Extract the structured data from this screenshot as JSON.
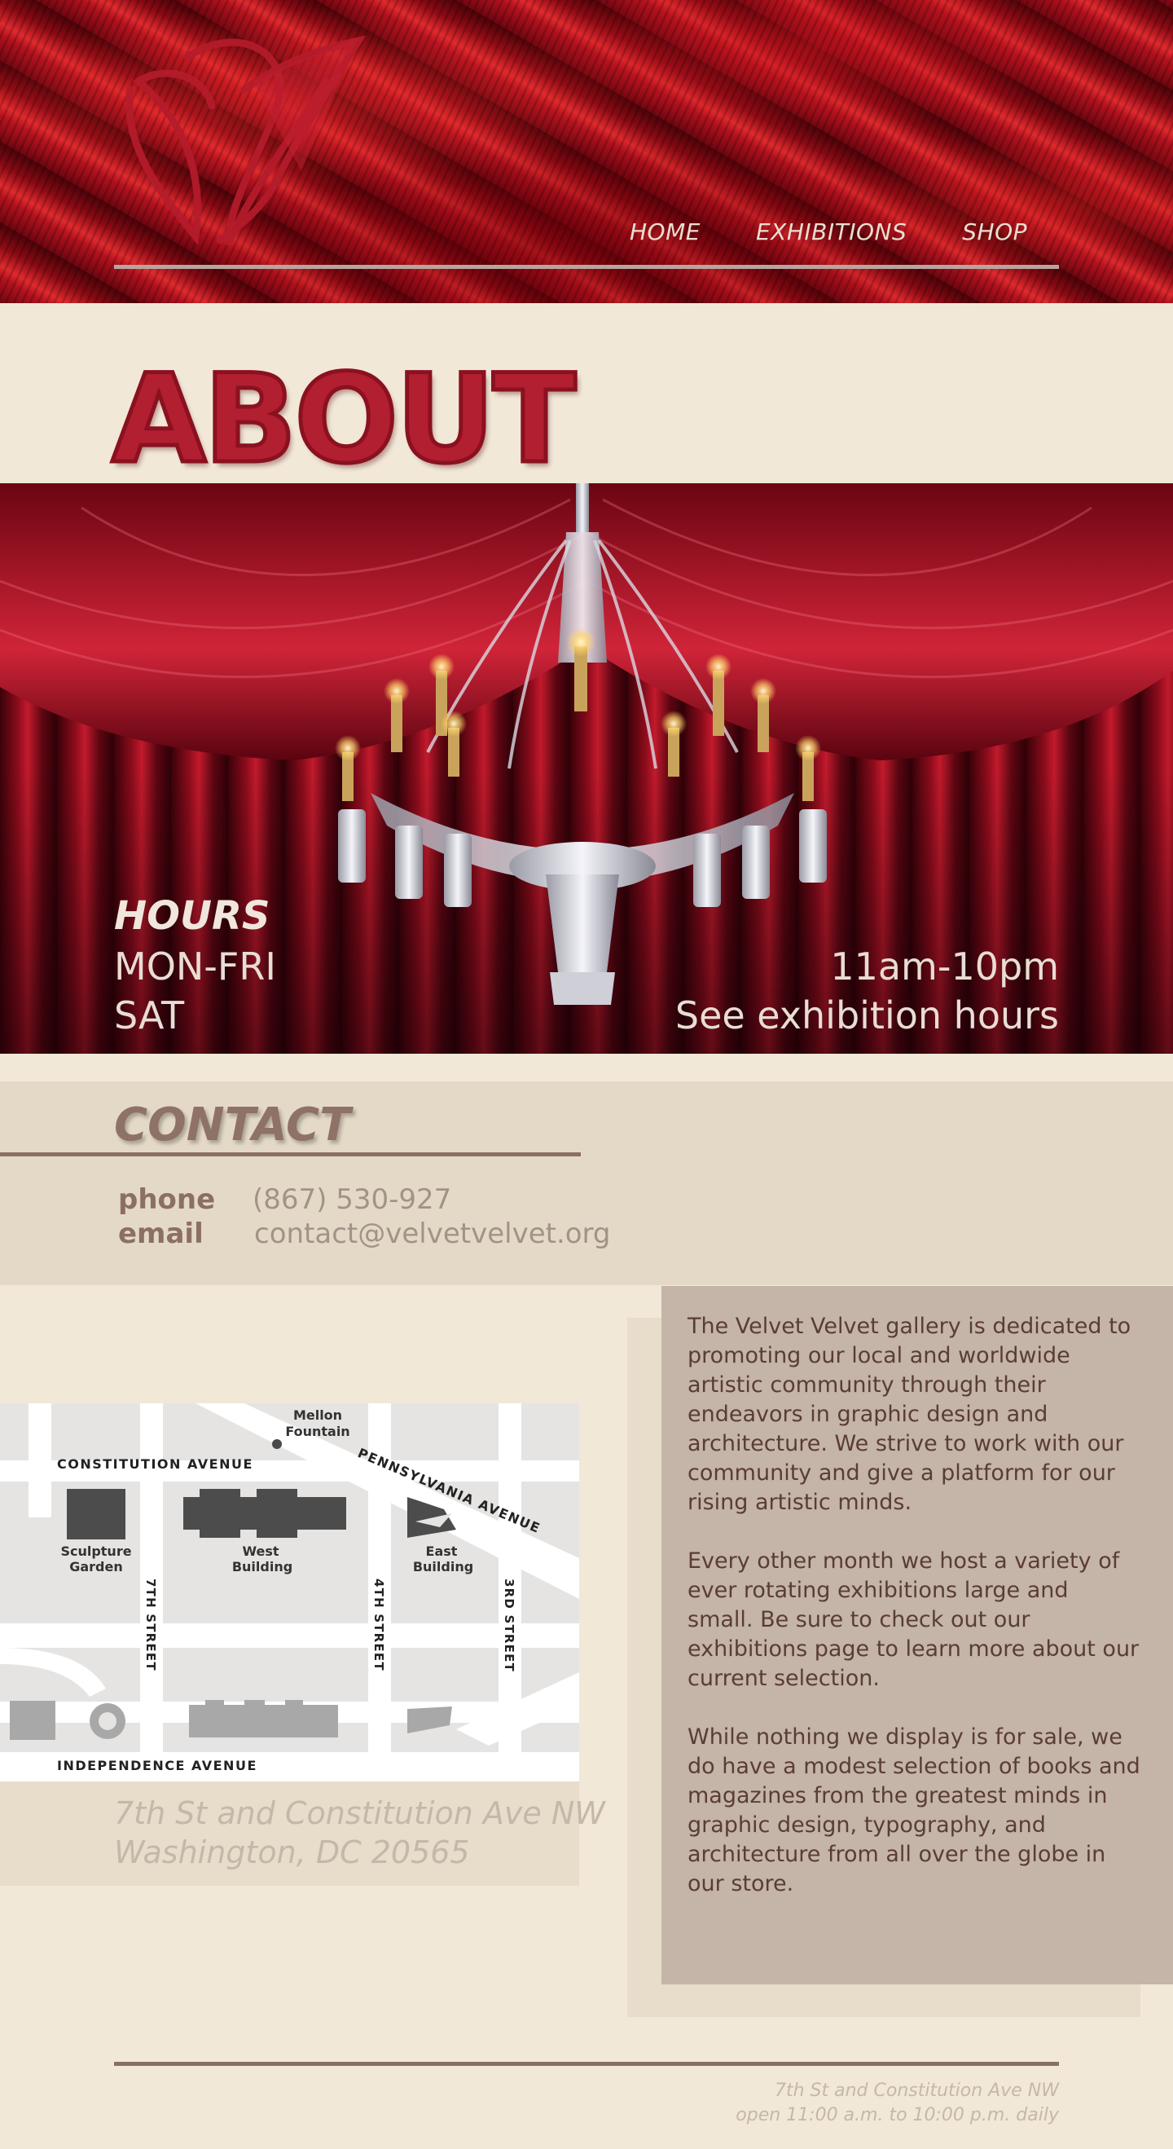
{
  "header": {
    "logo_icon": "velvet-v-monogram-logo",
    "nav": [
      {
        "label": "HOME"
      },
      {
        "label": "EXHIBITIONS"
      },
      {
        "label": "SHOP"
      }
    ]
  },
  "about": {
    "title": "ABOUT"
  },
  "hero": {
    "image": "chandelier-red-velvet-drapes",
    "hours_label": "HOURS",
    "days": [
      "MON-FRI",
      "SAT"
    ],
    "times": [
      "11am-10pm",
      "See exhibition hours"
    ]
  },
  "contact": {
    "title": "CONTACT",
    "phone_label": "phone",
    "phone_value": "(867) 530-927",
    "email_label": "email",
    "email_value": "contact@velvetvelvet.org"
  },
  "map": {
    "labels": {
      "mellon": "Mellon",
      "fountain": "Fountain",
      "constitution": "CONSTITUTION AVENUE",
      "pennsylvania": "PENNSYLVANIA AVENUE",
      "sculpture_1": "Sculpture",
      "sculpture_2": "Garden",
      "west_1": "West",
      "west_2": "Building",
      "east_1": "East",
      "east_2": "Building",
      "seventh": "7TH STREET",
      "fourth": "4TH STREET",
      "third": "3RD STREET",
      "independence": "INDEPENDENCE AVENUE"
    },
    "address_line_1": "7th St and Constitution Ave NW",
    "address_line_2": "Washington, DC 20565"
  },
  "about_text": {
    "paragraphs": [
      "The Velvet Velvet gallery is dedicated to promoting our local and worldwide artistic community through their endeavors in graphic design and architecture. We strive to work with our community and give a platform for our rising artistic minds.",
      "Every other month we host a variety of ever rotating exhibitions large and small. Be sure to check out our exhibitions page to learn more about our current selection.",
      "While nothing we display is for sale, we do have a modest selection of books and magazines from the greatest minds in graphic design, typography, and architecture from all over the globe in our store."
    ]
  },
  "footer": {
    "line_1": "7th St and Constitution Ave NW",
    "line_2": "open 11:00 a.m. to 10:00 p.m. daily"
  },
  "colors": {
    "background": "#f1e8d8",
    "accent_red": "#b21f30",
    "contact_band": "#e4d9c6",
    "brown": "#8c6f63",
    "about_box": "#c5b4a8"
  }
}
